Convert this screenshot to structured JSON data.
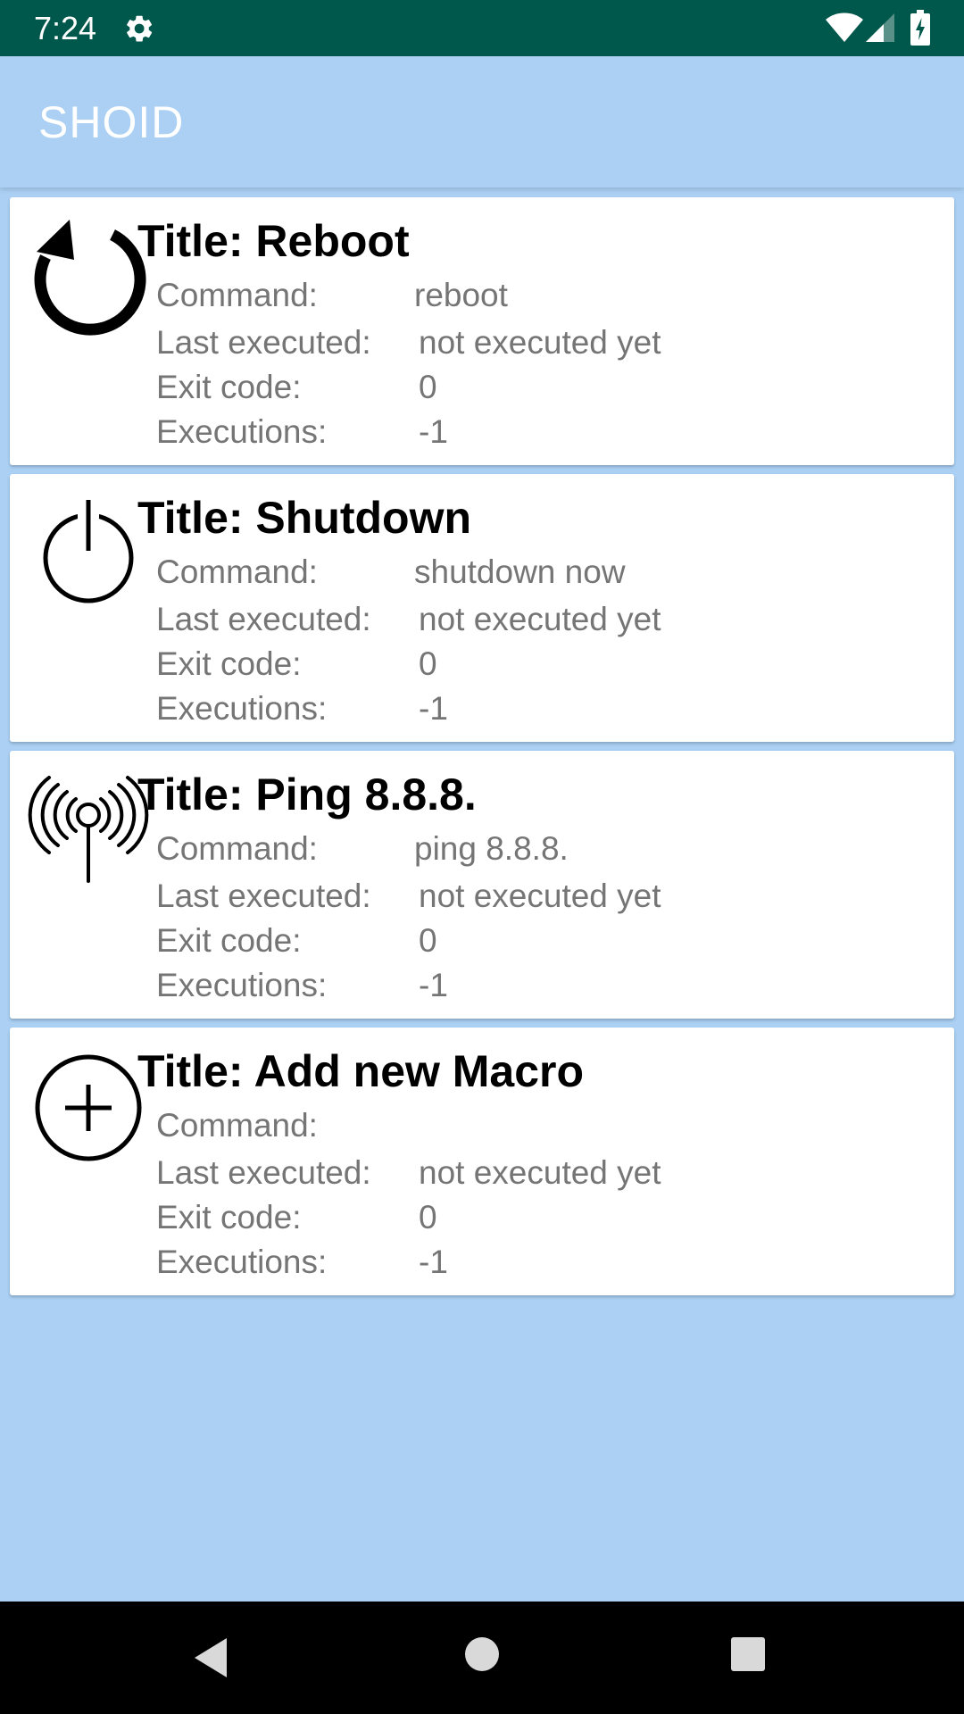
{
  "status_bar": {
    "time": "7:24",
    "icons": [
      "gear-icon",
      "wifi-icon",
      "signal-icon",
      "battery-icon"
    ],
    "background": "#00574b"
  },
  "app_bar": {
    "title": "SHOID",
    "background": "#abd0f4"
  },
  "labels": {
    "command": "Command:",
    "last_executed": "Last executed:",
    "exit_code": "Exit code:",
    "executions": "Executions:"
  },
  "macros": [
    {
      "icon": "reboot-icon",
      "title": "Title: Reboot",
      "command": "reboot",
      "last_executed": "not executed yet",
      "exit_code": "0",
      "executions": "-1"
    },
    {
      "icon": "power-icon",
      "title": "Title: Shutdown",
      "command": "shutdown now",
      "last_executed": "not executed yet",
      "exit_code": "0",
      "executions": "-1"
    },
    {
      "icon": "antenna-icon",
      "title": "Title: Ping 8.8.8.",
      "command": "ping 8.8.8.",
      "last_executed": "not executed yet",
      "exit_code": "0",
      "executions": "-1"
    },
    {
      "icon": "add-circle-icon",
      "title": "Title: Add new Macro",
      "command": "",
      "last_executed": "not executed yet",
      "exit_code": "0",
      "executions": "-1"
    }
  ],
  "nav_bar": {
    "icons": [
      "back-icon",
      "home-icon",
      "recents-icon"
    ]
  }
}
